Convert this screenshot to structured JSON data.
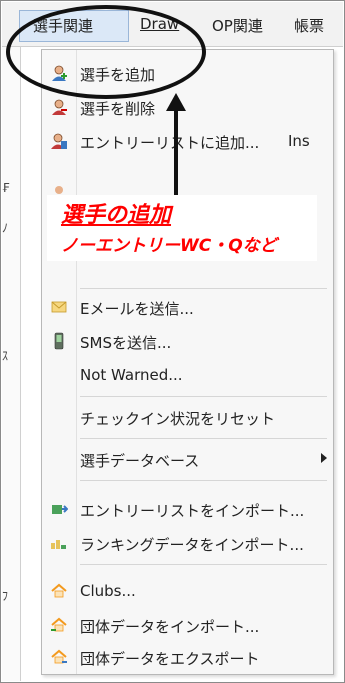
{
  "menubar": {
    "items": [
      {
        "label": "選手関連"
      },
      {
        "label": "Draw"
      },
      {
        "label": "OP関連"
      },
      {
        "label": "帳票"
      }
    ]
  },
  "menu": {
    "items": [
      {
        "label": "選手を追加",
        "icon": "add-player-icon"
      },
      {
        "label": "選手を削除",
        "icon": "delete-player-icon"
      },
      {
        "label": "エントリーリストに追加...",
        "shortcut": "Ins",
        "icon": "add-to-entry-list-icon"
      },
      {
        "label": "Eメールを送信...",
        "icon": "email-icon"
      },
      {
        "label": "SMSを送信...",
        "icon": "phone-icon"
      },
      {
        "label": "Not Warned..."
      },
      {
        "label": "チェックイン状況をリセット"
      },
      {
        "label": "選手データベース",
        "has_submenu": true
      },
      {
        "label": "エントリーリストをインポート...",
        "icon": "import-entry-list-icon"
      },
      {
        "label": "ランキングデータをインポート...",
        "icon": "import-ranking-icon"
      },
      {
        "label": "Clubs...",
        "icon": "club-house-icon"
      },
      {
        "label": "団体データをインポート...",
        "icon": "import-club-icon"
      },
      {
        "label": "団体データをエクスポート",
        "icon": "export-club-icon"
      }
    ]
  },
  "callout": {
    "title": "選手の追加",
    "subtitle": "ノーエントリーWC・Qなど"
  },
  "colors": {
    "callout_text": "#ff0000",
    "menu_bg": "#f7f7f7",
    "active_menubar": "#dbe8f7"
  }
}
